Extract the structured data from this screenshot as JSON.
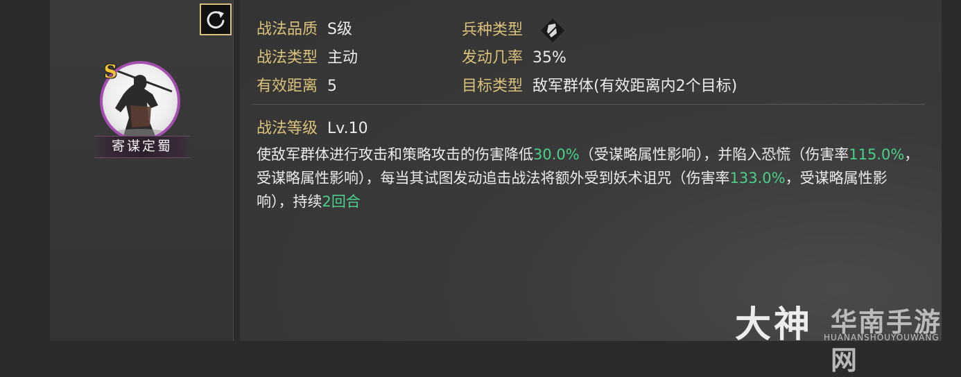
{
  "skill": {
    "name": "寄谋定蜀",
    "grade": "S"
  },
  "info": {
    "quality_label": "战法品质",
    "quality_value": "S级",
    "type_label": "战法类型",
    "type_value": "主动",
    "range_label": "有效距离",
    "range_value": "5",
    "troop_label": "兵种类型",
    "troop_icon": "troop-type-icon",
    "rate_label": "发动几率",
    "rate_value": "35%",
    "target_label": "目标类型",
    "target_value": "敌军群体(有效距离内2个目标)",
    "level_label": "战法等级",
    "level_value": "Lv.10"
  },
  "description": {
    "p1": "使敌军群体进行攻击和策略攻击的伤害降低",
    "v1": "30.0%",
    "p2": "（受谋略属性影响），并陷入恐慌（伤害率",
    "v2": "115.0%",
    "p3": "，受谋略属性影响），每当其试图发动追击战法将额外受到妖术诅咒（伤害率",
    "v3": "133.0%",
    "p4": "，受谋略属性影响），持续",
    "v4": "2回合"
  },
  "watermark": {
    "big": "大神",
    "cn": "华南手游网",
    "en": "HUANANSHOUYOUWANG"
  },
  "icons": {
    "refresh": "refresh-icon"
  },
  "colors": {
    "label": "#d9c27a",
    "highlight": "#4bd08a",
    "ring": "#a44fb0"
  }
}
